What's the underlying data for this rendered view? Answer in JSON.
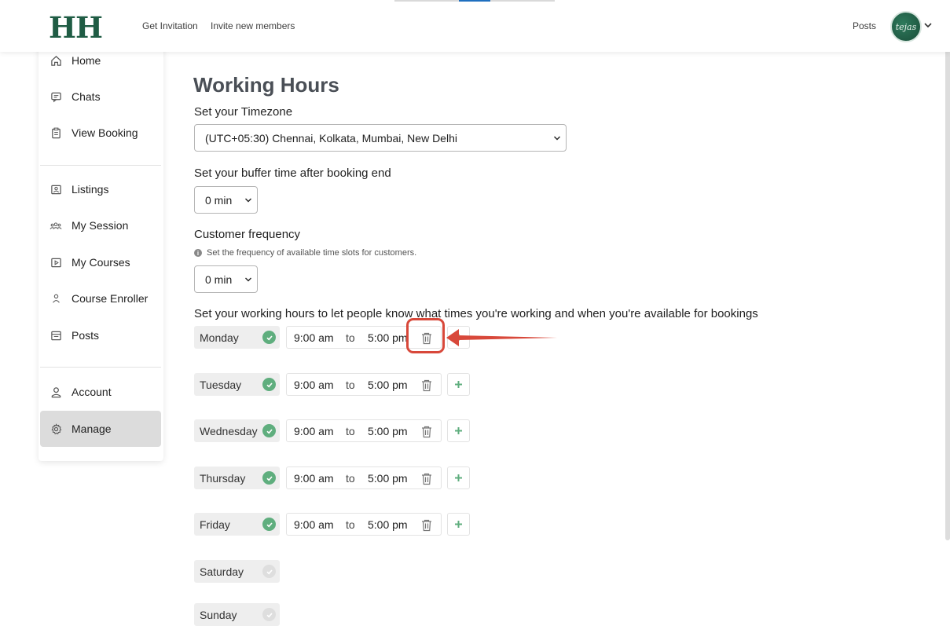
{
  "header": {
    "logo": "HH",
    "nav": [
      "Get Invitation",
      "Invite new members"
    ],
    "posts_link": "Posts",
    "avatar_text": "tejas"
  },
  "sidebar": {
    "items": [
      {
        "label": "Home",
        "icon": "home-icon"
      },
      {
        "label": "Chats",
        "icon": "chat-icon"
      },
      {
        "label": "View Booking",
        "icon": "clipboard-icon"
      },
      {
        "label": "Listings",
        "icon": "listing-icon"
      },
      {
        "label": "My Session",
        "icon": "group-icon"
      },
      {
        "label": "My Courses",
        "icon": "play-icon"
      },
      {
        "label": "Course Enroller",
        "icon": "user-icon"
      },
      {
        "label": "Posts",
        "icon": "posts-icon"
      },
      {
        "label": "Account",
        "icon": "account-icon"
      },
      {
        "label": "Manage",
        "icon": "gear-icon"
      }
    ],
    "active": "Manage"
  },
  "main": {
    "title": "Working Hours",
    "timezone_label": "Set your Timezone",
    "timezone_value": "(UTC+05:30) Chennai, Kolkata, Mumbai, New Delhi",
    "buffer_label": "Set your buffer time after booking end",
    "buffer_value": "0 min",
    "frequency_label": "Customer frequency",
    "frequency_hint": "Set the frequency of available time slots for customers.",
    "frequency_value": "0 min",
    "hours_label": "Set your working hours to let people know what times you're working and when you're available for bookings",
    "to_word": "to",
    "days": [
      {
        "name": "Monday",
        "enabled": true,
        "from": "9:00 am",
        "to": "5:00 pm"
      },
      {
        "name": "Tuesday",
        "enabled": true,
        "from": "9:00 am",
        "to": "5:00 pm"
      },
      {
        "name": "Wednesday",
        "enabled": true,
        "from": "9:00 am",
        "to": "5:00 pm"
      },
      {
        "name": "Thursday",
        "enabled": true,
        "from": "9:00 am",
        "to": "5:00 pm"
      },
      {
        "name": "Friday",
        "enabled": true,
        "from": "9:00 am",
        "to": "5:00 pm"
      },
      {
        "name": "Saturday",
        "enabled": false
      },
      {
        "name": "Sunday",
        "enabled": false
      }
    ]
  },
  "colors": {
    "brand": "#1f5c44",
    "check": "#5fae7e",
    "annotation": "#d8483a"
  }
}
